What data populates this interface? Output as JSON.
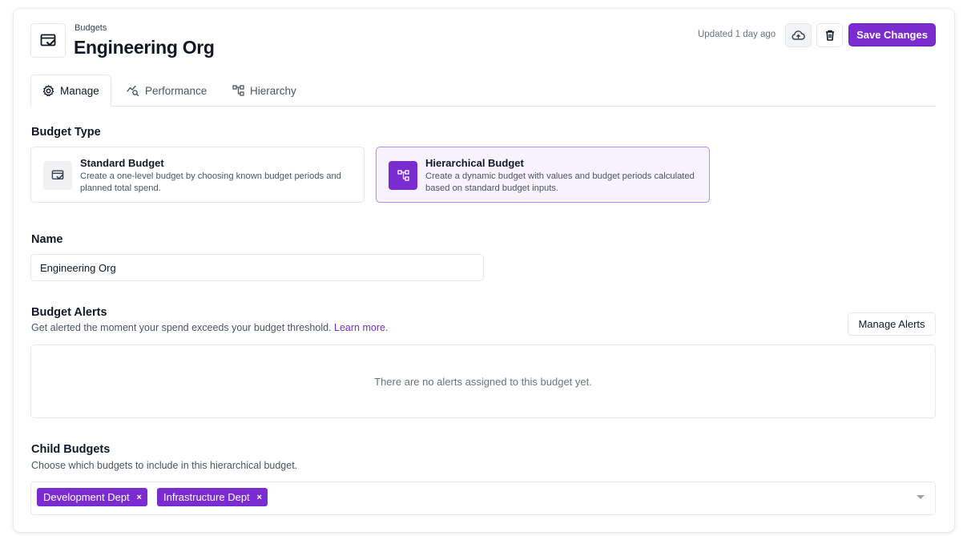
{
  "header": {
    "breadcrumb": "Budgets",
    "title": "Engineering Org",
    "updated": "Updated 1 day ago",
    "save_label": "Save Changes"
  },
  "tabs": [
    {
      "label": "Manage",
      "icon": "gear-icon",
      "active": true
    },
    {
      "label": "Performance",
      "icon": "performance-icon",
      "active": false
    },
    {
      "label": "Hierarchy",
      "icon": "hierarchy-icon",
      "active": false
    }
  ],
  "budget_type": {
    "title": "Budget Type",
    "options": [
      {
        "name": "Standard Budget",
        "desc": "Create a one-level budget by choosing known budget periods and planned total spend.",
        "selected": false
      },
      {
        "name": "Hierarchical Budget",
        "desc": "Create a dynamic budget with values and budget periods calculated based on standard budget inputs.",
        "selected": true
      }
    ]
  },
  "name_field": {
    "label": "Name",
    "value": "Engineering Org"
  },
  "alerts": {
    "title": "Budget Alerts",
    "desc": "Get alerted the moment your spend exceeds your budget threshold.",
    "link": "Learn more.",
    "manage_label": "Manage Alerts",
    "empty_text": "There are no alerts assigned to this budget yet."
  },
  "child_budgets": {
    "title": "Child Budgets",
    "desc": "Choose which budgets to include in this hierarchical budget.",
    "tags": [
      "Development Dept",
      "Infrastructure Dept"
    ],
    "remove_glyph": "×"
  },
  "colors": {
    "accent": "#7b2cd1",
    "selected_bg": "#f7f2fd",
    "selected_border": "#b58ae6"
  }
}
